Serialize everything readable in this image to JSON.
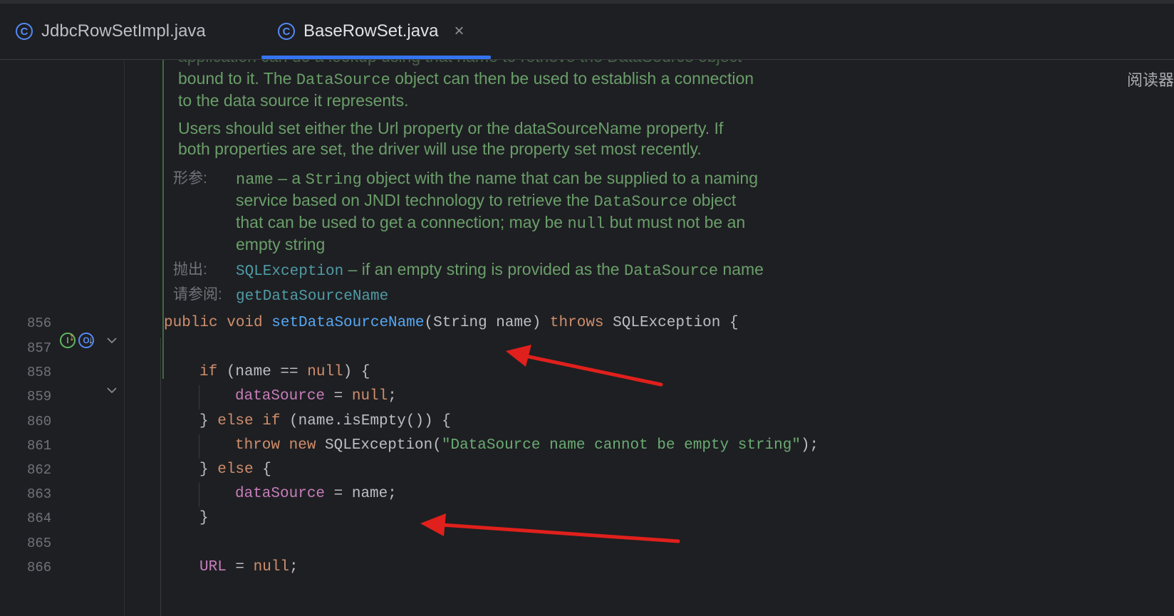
{
  "tabs": [
    {
      "label": "JdbcRowSetImpl.java",
      "active": false
    },
    {
      "label": "BaseRowSet.java",
      "active": true
    }
  ],
  "close_glyph": "×",
  "reader_mode_label": "阅读器",
  "doc": {
    "cutoff_line": "application can do a lookup using that name to retrieve the DataSource object",
    "p1_line1_a": "bound to it. The ",
    "p1_line1_code": "DataSource",
    "p1_line1_b": " object can then be used to establish a connection",
    "p1_line2": "to the data source it represents.",
    "p2_line1": "Users should set either the Url property or the dataSourceName property. If",
    "p2_line2": "both properties are set, the driver will use the property set most recently.",
    "param_tag": "形参:",
    "param_name": "name",
    "param_t1": " – a ",
    "param_code1": "String",
    "param_t2": " object with the name that can be supplied to a naming",
    "param_line2_a": "service based on JNDI technology to retrieve the ",
    "param_line2_code": "DataSource",
    "param_line2_b": " object",
    "param_line3_a": "that can be used to get a connection; may be ",
    "param_line3_code": "null",
    "param_line3_b": " but must not be an",
    "param_line4": "empty string",
    "throws_tag": "抛出:",
    "throws_link": "SQLException",
    "throws_t1": " – if an empty string is provided as the ",
    "throws_code": "DataSource",
    "throws_t2": " name",
    "see_tag": "请参阅:",
    "see_link": "getDataSourceName"
  },
  "gutter_icons": [
    "implementation-icon",
    "override-icon"
  ],
  "line_numbers": [
    "856",
    "857",
    "858",
    "859",
    "860",
    "861",
    "862",
    "863",
    "864",
    "865",
    "866"
  ],
  "code": {
    "l856": {
      "a": "public void ",
      "fn": "setDataSourceName",
      "b": "(String name) ",
      "kw": "throws",
      "c": " SQLException {"
    },
    "l858": {
      "kw": "if",
      "a": " (name == ",
      "kw2": "null",
      "b": ") {"
    },
    "l859": {
      "fld": "dataSource",
      "a": " = ",
      "kw": "null",
      "b": ";"
    },
    "l860": {
      "a": "} ",
      "kw": "else if",
      "b": " (name.isEmpty()) {"
    },
    "l861": {
      "kw": "throw new",
      "a": " SQLException(",
      "str": "\"DataSource name cannot be empty string\"",
      "b": ");"
    },
    "l862": {
      "a": "} ",
      "kw": "else",
      "b": " {"
    },
    "l863": {
      "fld": "dataSource",
      "a": " = name;"
    },
    "l864": {
      "a": "}"
    },
    "l866": {
      "fld": "URL",
      "a": " = ",
      "kw": "null",
      "b": ";"
    }
  },
  "colors": {
    "background": "#1e1f22",
    "keyword": "#cf8e6d",
    "function": "#56a8f5",
    "field": "#c77dbb",
    "string": "#6aab73",
    "doc_text": "#6a9e6a",
    "annotation_arrow": "#e0201c",
    "tab_accent": "#3574f0"
  }
}
